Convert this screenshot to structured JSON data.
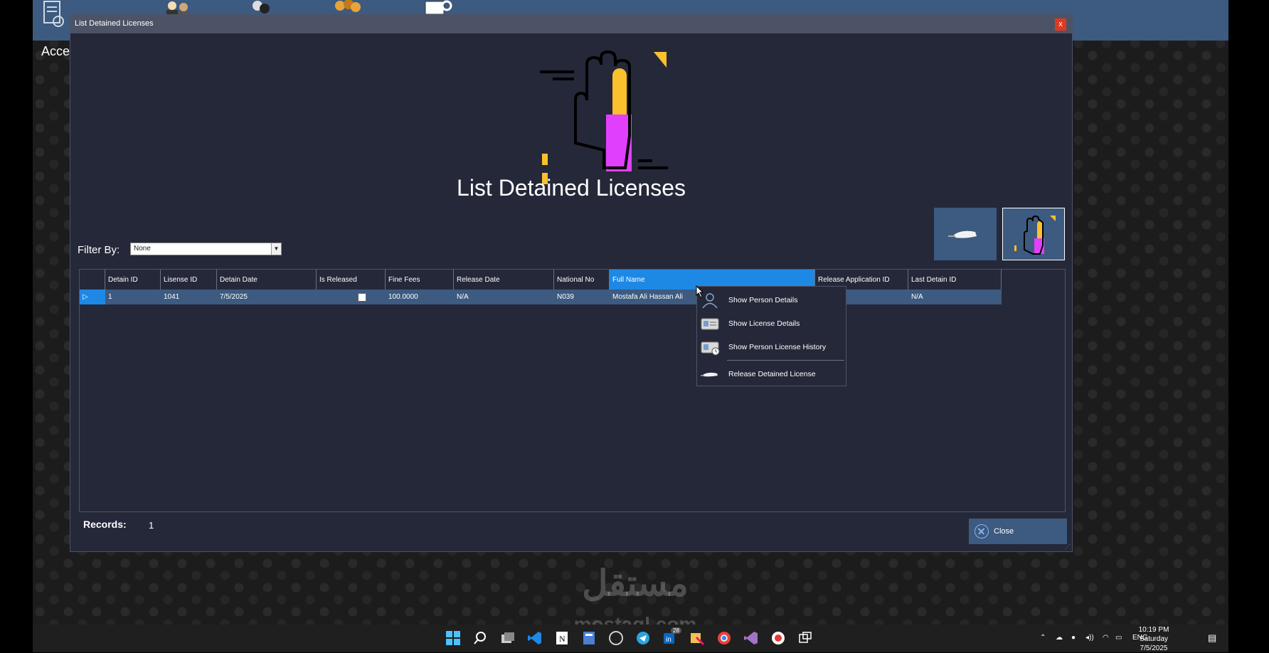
{
  "app": {
    "accent_label": "Acce"
  },
  "window": {
    "title": "List Detained Licenses",
    "close_glyph": "x",
    "page_title": "List Detained Licenses"
  },
  "filter": {
    "label": "Filter By:",
    "selected": "None"
  },
  "table": {
    "columns": [
      "",
      "Detain ID",
      "Lisense ID",
      "Detain Date",
      "Is Released",
      "Fine Fees",
      "Release Date",
      "National No",
      "Full Name",
      "Release Application ID",
      "Last Detain ID"
    ],
    "rows": [
      {
        "detain_id": "1",
        "license_id": "1041",
        "detain_date": "7/5/2025",
        "is_released": false,
        "fine_fees": "100.0000",
        "release_date": "N/A",
        "national_no": "N039",
        "full_name": "Mostafa Ali Hassan Ali",
        "release_application_id": "",
        "last_detain_id": "N/A"
      }
    ]
  },
  "context_menu": {
    "items": [
      {
        "label": "Show Person Details",
        "icon": "person-icon"
      },
      {
        "label": "Show License Details",
        "icon": "license-card-icon"
      },
      {
        "label": "Show Person License History",
        "icon": "license-history-icon"
      },
      {
        "label": "Release Detained License",
        "icon": "release-license-icon"
      }
    ]
  },
  "footer": {
    "records_label": "Records:",
    "records_count": "1",
    "close_label": "Close"
  },
  "watermark": {
    "arabic": "مستقل",
    "latin": "mostaql.com"
  },
  "taskbar": {
    "language": "ENG",
    "time": "10:19 PM",
    "day": "Saturday",
    "date": "7/5/2025",
    "linkedin_badge": "28"
  },
  "colors": {
    "window_bg": "#252839",
    "titlebar": "#4d5366",
    "selection_blue": "#1e88e5",
    "row_bg": "#3d5a80",
    "close_red": "#e0391f",
    "accent_magenta": "#e040fb",
    "accent_yellow": "#fbc02d"
  }
}
